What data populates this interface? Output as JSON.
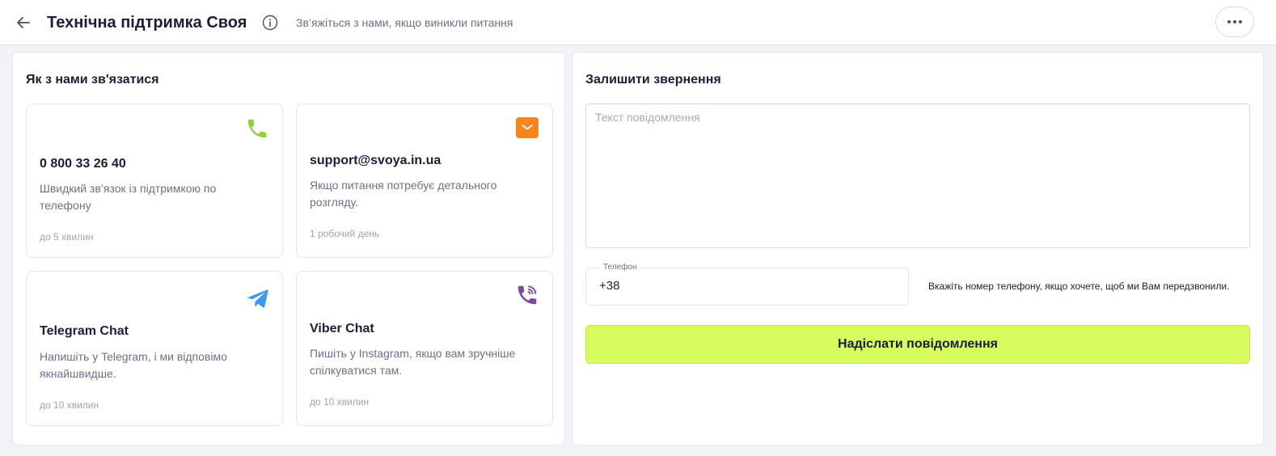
{
  "header": {
    "title": "Технічна підтримка Своя",
    "subtitle": "Зв’яжіться з нами, якщо виникли питання",
    "back_icon": "arrow-left-icon",
    "info_icon": "info-circle-icon",
    "more_icon": "ellipsis-icon"
  },
  "contacts": {
    "title": "Як з нами зв'язатися",
    "cards": [
      {
        "icon": "phone-icon",
        "icon_color": "#8cd43a",
        "title": "0 800 33 26 40",
        "description": "Швидкий зв’язок із підтримкою по телефону",
        "time": "до 5 хвилин"
      },
      {
        "icon": "mail-icon",
        "icon_color": "#f7841f",
        "title": "support@svoya.in.ua",
        "description": "Якщо питання потребує детального розгляду.",
        "time": "1 робочий день"
      },
      {
        "icon": "telegram-icon",
        "icon_color": "#3d9aef",
        "title": "Telegram Chat",
        "description": "Напишіть у Telegram, і ми відповімо якнайшвидше.",
        "time": "до 10 хвилин"
      },
      {
        "icon": "viber-icon",
        "icon_color": "#7b4aa3",
        "title": "Viber Chat",
        "description": "Пишіть у Instagram, якщо вам зручніше спілкуватися там.",
        "time": "до 10 хвилин"
      }
    ]
  },
  "form": {
    "title": "Залишити звернення",
    "message_placeholder": "Текст повідомлення",
    "message_value": "",
    "phone_label": "Телефон",
    "phone_value": "+38",
    "phone_hint": "Вкажіть номер телефону, якщо хочете, щоб ми Вам передзвонили.",
    "submit_label": "Надіслати повідомлення",
    "submit_color": "#d8fb5d"
  }
}
